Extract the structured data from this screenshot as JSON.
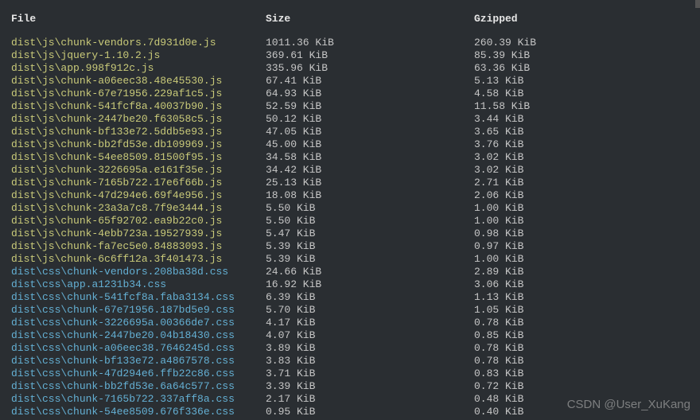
{
  "headers": {
    "file": "File",
    "size": "Size",
    "gzip": "Gzipped"
  },
  "rows": [
    {
      "dir": "dist\\js\\",
      "name": "chunk-vendors",
      "hash": "7d931d0e",
      "ext": "js",
      "size": "1011.36 KiB",
      "gzip": "260.39 KiB"
    },
    {
      "dir": "dist\\js\\",
      "name": "jquery-1.10.2",
      "hash": "",
      "ext": "js",
      "size": "369.61 KiB",
      "gzip": "85.39 KiB"
    },
    {
      "dir": "dist\\js\\",
      "name": "app",
      "hash": "998f912c",
      "ext": "js",
      "size": "335.96 KiB",
      "gzip": "63.36 KiB"
    },
    {
      "dir": "dist\\js\\",
      "name": "chunk-a06eec38",
      "hash": "48e45530",
      "ext": "js",
      "size": "67.41 KiB",
      "gzip": "5.13 KiB"
    },
    {
      "dir": "dist\\js\\",
      "name": "chunk-67e71956",
      "hash": "229af1c5",
      "ext": "js",
      "size": "64.93 KiB",
      "gzip": "4.58 KiB"
    },
    {
      "dir": "dist\\js\\",
      "name": "chunk-541fcf8a",
      "hash": "40037b90",
      "ext": "js",
      "size": "52.59 KiB",
      "gzip": "11.58 KiB"
    },
    {
      "dir": "dist\\js\\",
      "name": "chunk-2447be20",
      "hash": "f63058c5",
      "ext": "js",
      "size": "50.12 KiB",
      "gzip": "3.44 KiB"
    },
    {
      "dir": "dist\\js\\",
      "name": "chunk-bf133e72",
      "hash": "5ddb5e93",
      "ext": "js",
      "size": "47.05 KiB",
      "gzip": "3.65 KiB"
    },
    {
      "dir": "dist\\js\\",
      "name": "chunk-bb2fd53e",
      "hash": "db109969",
      "ext": "js",
      "size": "45.00 KiB",
      "gzip": "3.76 KiB"
    },
    {
      "dir": "dist\\js\\",
      "name": "chunk-54ee8509",
      "hash": "81500f95",
      "ext": "js",
      "size": "34.58 KiB",
      "gzip": "3.02 KiB"
    },
    {
      "dir": "dist\\js\\",
      "name": "chunk-3226695a",
      "hash": "e161f35e",
      "ext": "js",
      "size": "34.42 KiB",
      "gzip": "3.02 KiB"
    },
    {
      "dir": "dist\\js\\",
      "name": "chunk-7165b722",
      "hash": "17e6f66b",
      "ext": "js",
      "size": "25.13 KiB",
      "gzip": "2.71 KiB"
    },
    {
      "dir": "dist\\js\\",
      "name": "chunk-47d294e6",
      "hash": "69f4e956",
      "ext": "js",
      "size": "18.08 KiB",
      "gzip": "2.06 KiB"
    },
    {
      "dir": "dist\\js\\",
      "name": "chunk-23a3a7c8",
      "hash": "7f9e3444",
      "ext": "js",
      "size": "5.50 KiB",
      "gzip": "1.00 KiB"
    },
    {
      "dir": "dist\\js\\",
      "name": "chunk-65f92702",
      "hash": "ea9b22c0",
      "ext": "js",
      "size": "5.50 KiB",
      "gzip": "1.00 KiB"
    },
    {
      "dir": "dist\\js\\",
      "name": "chunk-4ebb723a",
      "hash": "19527939",
      "ext": "js",
      "size": "5.47 KiB",
      "gzip": "0.98 KiB"
    },
    {
      "dir": "dist\\js\\",
      "name": "chunk-fa7ec5e0",
      "hash": "84883093",
      "ext": "js",
      "size": "5.39 KiB",
      "gzip": "0.97 KiB"
    },
    {
      "dir": "dist\\js\\",
      "name": "chunk-6c6ff12a",
      "hash": "3f401473",
      "ext": "js",
      "size": "5.39 KiB",
      "gzip": "1.00 KiB"
    },
    {
      "dir": "dist\\css\\",
      "name": "chunk-vendors",
      "hash": "208ba38d",
      "ext": "css",
      "size": "24.66 KiB",
      "gzip": "2.89 KiB"
    },
    {
      "dir": "dist\\css\\",
      "name": "app",
      "hash": "a1231b34",
      "ext": "css",
      "size": "16.92 KiB",
      "gzip": "3.06 KiB"
    },
    {
      "dir": "dist\\css\\",
      "name": "chunk-541fcf8a",
      "hash": "faba3134",
      "ext": "css",
      "size": "6.39 KiB",
      "gzip": "1.13 KiB"
    },
    {
      "dir": "dist\\css\\",
      "name": "chunk-67e71956",
      "hash": "187bd5e9",
      "ext": "css",
      "size": "5.70 KiB",
      "gzip": "1.05 KiB"
    },
    {
      "dir": "dist\\css\\",
      "name": "chunk-3226695a",
      "hash": "00366de7",
      "ext": "css",
      "size": "4.17 KiB",
      "gzip": "0.78 KiB"
    },
    {
      "dir": "dist\\css\\",
      "name": "chunk-2447be20",
      "hash": "04b18430",
      "ext": "css",
      "size": "4.07 KiB",
      "gzip": "0.85 KiB"
    },
    {
      "dir": "dist\\css\\",
      "name": "chunk-a06eec38",
      "hash": "7646245d",
      "ext": "css",
      "size": "3.89 KiB",
      "gzip": "0.78 KiB"
    },
    {
      "dir": "dist\\css\\",
      "name": "chunk-bf133e72",
      "hash": "a4867578",
      "ext": "css",
      "size": "3.83 KiB",
      "gzip": "0.78 KiB"
    },
    {
      "dir": "dist\\css\\",
      "name": "chunk-47d294e6",
      "hash": "ffb22c86",
      "ext": "css",
      "size": "3.71 KiB",
      "gzip": "0.83 KiB"
    },
    {
      "dir": "dist\\css\\",
      "name": "chunk-bb2fd53e",
      "hash": "6a64c577",
      "ext": "css",
      "size": "3.39 KiB",
      "gzip": "0.72 KiB"
    },
    {
      "dir": "dist\\css\\",
      "name": "chunk-7165b722",
      "hash": "337aff8a",
      "ext": "css",
      "size": "2.17 KiB",
      "gzip": "0.48 KiB"
    },
    {
      "dir": "dist\\css\\",
      "name": "chunk-54ee8509",
      "hash": "676f336e",
      "ext": "css",
      "size": "0.95 KiB",
      "gzip": "0.40 KiB"
    }
  ],
  "watermark": "CSDN @User_XuKang"
}
